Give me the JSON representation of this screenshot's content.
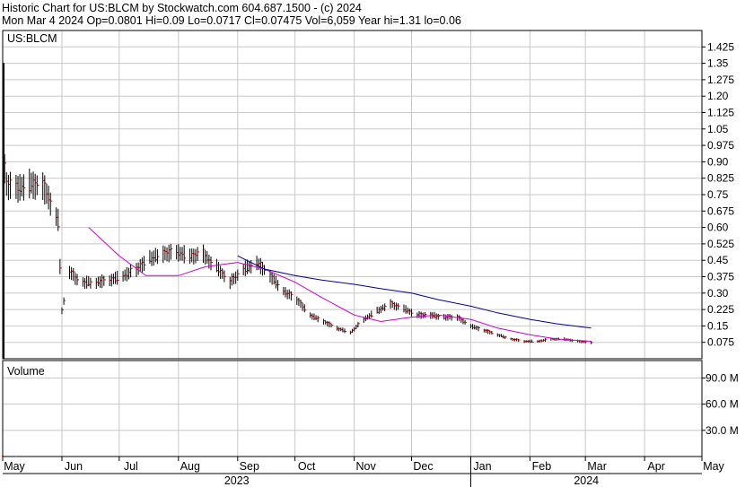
{
  "header": {
    "line1": "Historic Chart for US:BLCM by Stockwatch.com 604.687.1500 - (c) 2024",
    "line2": "Mon Mar  4 2024   Op=0.0801  Hi=0.09  Lo=0.0717  Cl=0.07475  Vol=6,059  Year hi=1.31  lo=0.06"
  },
  "colors": {
    "background": "#ffffff",
    "grid": "#c8c8c8",
    "bars": "#000000",
    "close_tick": "#cc0000",
    "ma_short": "#cc00cc",
    "ma_long": "#000099",
    "volume": "#cc0000"
  },
  "chart_data": [
    {
      "type": "line",
      "panel": "price",
      "title": "US:BLCM",
      "ylim": [
        0.0,
        1.5
      ],
      "y_ticks": [
        "1.425",
        "1.35",
        "1.275",
        "1.20",
        "1.125",
        "1.05",
        "0.975",
        "0.90",
        "0.825",
        "0.75",
        "0.675",
        "0.60",
        "0.525",
        "0.45",
        "0.375",
        "0.30",
        "0.225",
        "0.15",
        "0.075"
      ],
      "x_months": [
        "May",
        "Jun",
        "Jul",
        "Aug",
        "Sep",
        "Oct",
        "Nov",
        "Dec",
        "Jan",
        "Feb",
        "Mar",
        "Apr",
        "May"
      ],
      "x_years": [
        "2023",
        "2024"
      ],
      "grid": true,
      "series": [
        {
          "kind": "price",
          "x": [
            "2023-05-01",
            "2023-05-03",
            "2023-05-08",
            "2023-05-15",
            "2023-05-22",
            "2023-05-25",
            "2023-05-30",
            "2023-06-01",
            "2023-06-05",
            "2023-06-08",
            "2023-06-12",
            "2023-06-19",
            "2023-06-26",
            "2023-07-03",
            "2023-07-10",
            "2023-07-17",
            "2023-07-24",
            "2023-07-31",
            "2023-08-07",
            "2023-08-14",
            "2023-08-17",
            "2023-08-21",
            "2023-08-28",
            "2023-09-04",
            "2023-09-11",
            "2023-09-18",
            "2023-09-25",
            "2023-10-02",
            "2023-10-09",
            "2023-10-16",
            "2023-10-23",
            "2023-10-30",
            "2023-11-06",
            "2023-11-13",
            "2023-11-20",
            "2023-11-27",
            "2023-12-04",
            "2023-12-11",
            "2023-12-18",
            "2023-12-25",
            "2024-01-01",
            "2024-01-08",
            "2024-01-15",
            "2024-01-22",
            "2024-01-29",
            "2024-02-05",
            "2024-02-12",
            "2024-02-19",
            "2024-02-26",
            "2024-03-04"
          ],
          "values": [
            0.93,
            0.8,
            0.78,
            0.8,
            0.79,
            0.74,
            0.63,
            0.22,
            0.4,
            0.37,
            0.35,
            0.35,
            0.36,
            0.38,
            0.41,
            0.46,
            0.48,
            0.49,
            0.47,
            0.48,
            0.45,
            0.42,
            0.35,
            0.41,
            0.44,
            0.38,
            0.31,
            0.27,
            0.2,
            0.17,
            0.14,
            0.12,
            0.18,
            0.22,
            0.25,
            0.23,
            0.2,
            0.2,
            0.19,
            0.19,
            0.15,
            0.13,
            0.11,
            0.09,
            0.08,
            0.08,
            0.09,
            0.09,
            0.08,
            0.075
          ]
        },
        {
          "kind": "ma_short",
          "x": [
            "2023-06-15",
            "2023-07-01",
            "2023-07-15",
            "2023-08-01",
            "2023-08-15",
            "2023-09-01",
            "2023-09-15",
            "2023-10-01",
            "2023-10-15",
            "2023-11-01",
            "2023-11-15",
            "2023-12-01",
            "2023-12-15",
            "2024-01-01",
            "2024-01-15",
            "2024-02-01",
            "2024-02-15",
            "2024-03-04"
          ],
          "values": [
            0.6,
            0.47,
            0.38,
            0.38,
            0.42,
            0.44,
            0.41,
            0.35,
            0.28,
            0.2,
            0.17,
            0.19,
            0.2,
            0.18,
            0.14,
            0.11,
            0.09,
            0.08
          ]
        },
        {
          "kind": "ma_long",
          "x": [
            "2023-09-01",
            "2023-09-15",
            "2023-10-01",
            "2023-10-15",
            "2023-11-01",
            "2023-11-15",
            "2023-12-01",
            "2023-12-15",
            "2024-01-01",
            "2024-01-15",
            "2024-02-01",
            "2024-02-15",
            "2024-03-04"
          ],
          "values": [
            0.47,
            0.41,
            0.38,
            0.36,
            0.34,
            0.32,
            0.3,
            0.27,
            0.24,
            0.21,
            0.18,
            0.16,
            0.14
          ]
        }
      ]
    },
    {
      "type": "bar",
      "panel": "volume",
      "title": "Volume",
      "ylim": [
        0,
        110
      ],
      "y_unit": "M",
      "y_ticks": [
        "90.0 M",
        "60.0 M",
        "30.0 M"
      ],
      "x": [
        "2023-05-01",
        "2023-05-08"
      ],
      "values": [
        1.0,
        0.5
      ]
    }
  ]
}
